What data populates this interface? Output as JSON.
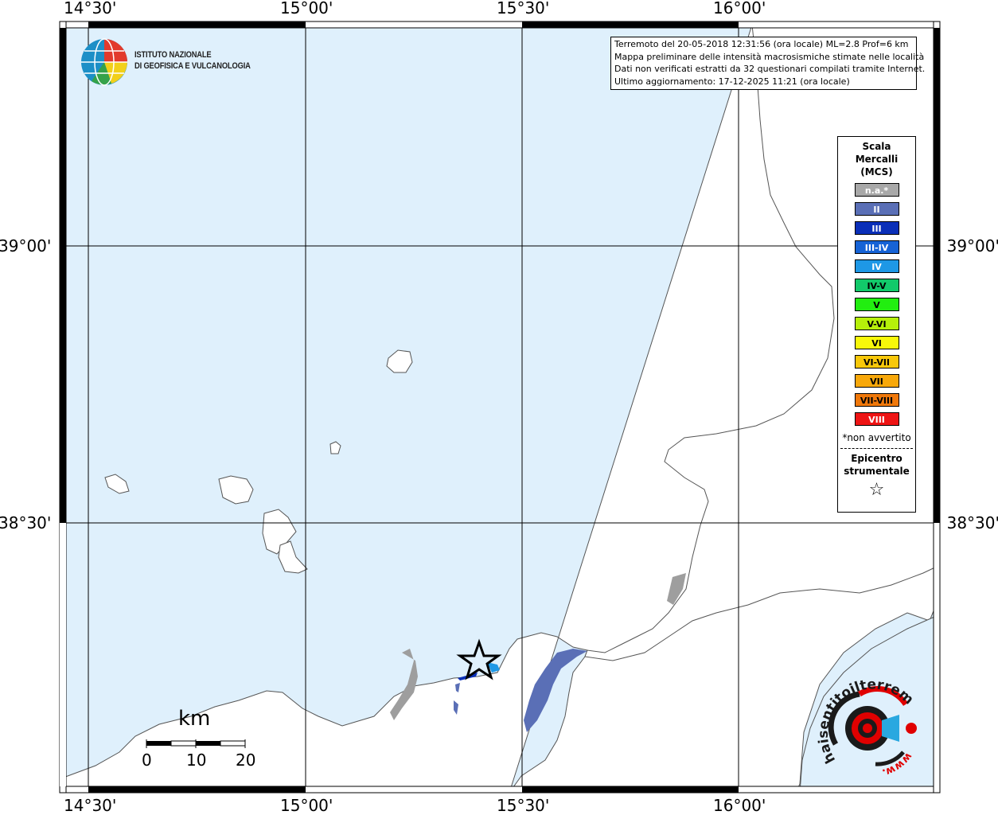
{
  "map": {
    "top_ticks": [
      "14°30'",
      "15°00'",
      "15°30'",
      "16°00'"
    ],
    "bottom_ticks": [
      "14°30'",
      "15°00'",
      "15°30'",
      "16°00'"
    ],
    "left_ticks": [
      "39°00'",
      "38°30'"
    ],
    "right_ticks": [
      "39°00'",
      "38°30'"
    ],
    "colors": {
      "sea": "#dff0fc",
      "land": "#ffffff",
      "intensity_II": "#5a6fb6",
      "intensity_IV": "#1e8ee0",
      "na": "#9e9e9e"
    }
  },
  "logo": {
    "line1": "ISTITUTO NAZIONALE",
    "line2": "DI GEOFISICA E VULCANOLOGIA"
  },
  "info": {
    "line1": "Terremoto del 20-05-2018 12:31:56 (ora locale) ML=2.8 Prof=6 km",
    "line2": "Mappa preliminare delle intensità macrosismiche stimate nelle località",
    "line3": "Dati non verificati estratti da 32 questionari compilati tramite Internet.",
    "line4": "Ultimo aggiornamento: 17-12-2025 11:21 (ora locale)"
  },
  "legend": {
    "title1": "Scala",
    "title2": "Mercalli",
    "title3": "(MCS)",
    "items": [
      {
        "label": "n.a.*",
        "color": "#a8a8a8",
        "text": "#ffffff"
      },
      {
        "label": "II",
        "color": "#5a6fb6",
        "text": "#ffffff"
      },
      {
        "label": "III",
        "color": "#0a2fb8",
        "text": "#ffffff"
      },
      {
        "label": "III-IV",
        "color": "#1663d6",
        "text": "#ffffff"
      },
      {
        "label": "IV",
        "color": "#1e98e6",
        "text": "#ffffff"
      },
      {
        "label": "IV-V",
        "color": "#12c96a",
        "text": "#000000"
      },
      {
        "label": "V",
        "color": "#22ee10",
        "text": "#000000"
      },
      {
        "label": "V-VI",
        "color": "#b6f00a",
        "text": "#000000"
      },
      {
        "label": "VI",
        "color": "#f8f80a",
        "text": "#000000"
      },
      {
        "label": "VI-VII",
        "color": "#f8c80a",
        "text": "#000000"
      },
      {
        "label": "VII",
        "color": "#f8a80a",
        "text": "#000000"
      },
      {
        "label": "VII-VIII",
        "color": "#f0780a",
        "text": "#000000"
      },
      {
        "label": "VIII",
        "color": "#ee1414",
        "text": "#ffffff"
      }
    ],
    "note": "*non avvertito",
    "epi1": "Epicentro",
    "epi2": "strumentale",
    "star": "☆"
  },
  "scalebar": {
    "unit": "km",
    "labels": [
      "0",
      "10",
      "20"
    ]
  },
  "haisentito": {
    "text": "haisentitoilterremoto.it",
    "www": "www."
  }
}
